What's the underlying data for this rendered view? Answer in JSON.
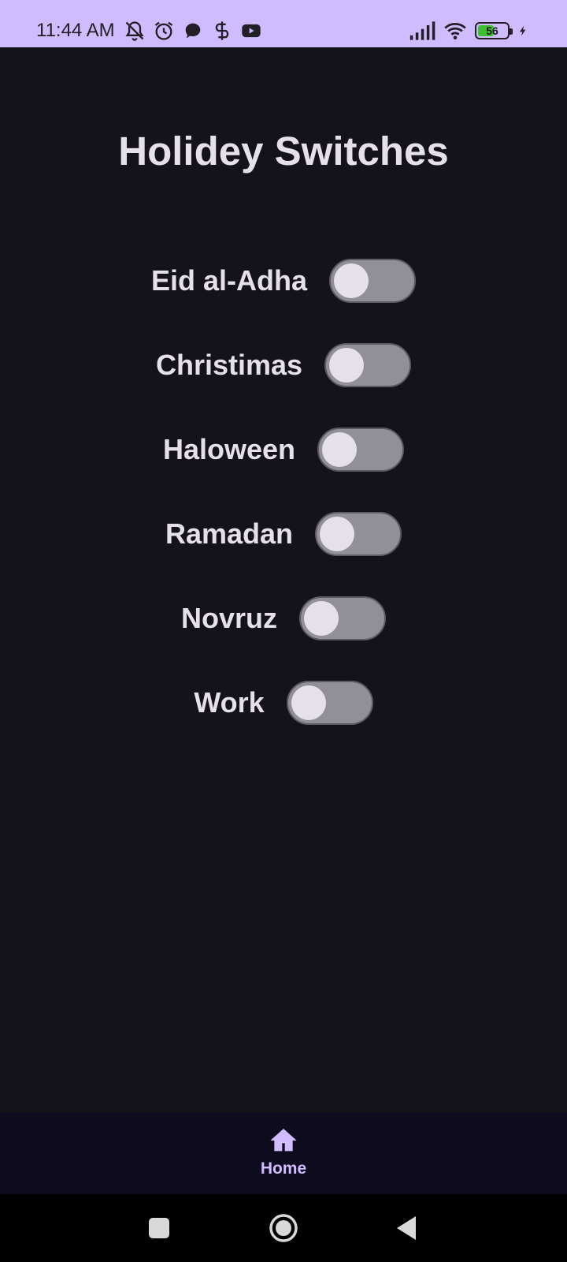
{
  "status_bar": {
    "time": "11:44 AM",
    "left_icons": [
      "bell-muted-icon",
      "alarm-icon",
      "chat-bubble-icon",
      "notification-app-icon",
      "youtube-icon"
    ],
    "right_icons": [
      "signal-icon",
      "wifi-icon",
      "battery-icon",
      "charging-icon"
    ],
    "battery_percent": "56",
    "battery_level": 0.56,
    "battery_color": "#3fbf33"
  },
  "page": {
    "title": "Holidey Switches"
  },
  "switches": [
    {
      "label": "Eid al-Adha",
      "checked": false
    },
    {
      "label": "Christimas",
      "checked": false
    },
    {
      "label": "Haloween",
      "checked": false
    },
    {
      "label": "Ramadan",
      "checked": false
    },
    {
      "label": "Novruz",
      "checked": false
    },
    {
      "label": "Work",
      "checked": false
    }
  ],
  "bottom_nav": {
    "items": [
      {
        "label": "Home",
        "icon": "home-icon",
        "selected": true
      }
    ]
  },
  "system_nav": {
    "buttons": [
      "recents-button",
      "home-button",
      "back-button"
    ]
  },
  "colors": {
    "background": "#15131a",
    "status_bar": "#cfbcff",
    "accent": "#d0bcff",
    "switch_track_off": "#918f98",
    "switch_thumb": "#e6e0eb",
    "bottom_nav_bg": "#0e0b1f"
  }
}
